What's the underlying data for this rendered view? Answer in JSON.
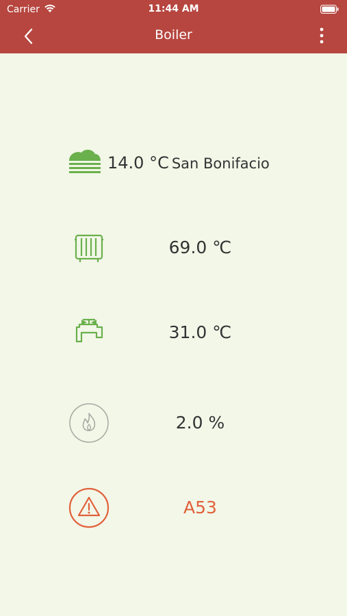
{
  "status_bar": {
    "carrier": "Carrier",
    "time": "11:44 AM"
  },
  "nav": {
    "title": "Boiler",
    "back_icon": "chevron-left-icon",
    "menu_icon": "more-vertical-icon"
  },
  "outdoor": {
    "temperature": "14.0 °C",
    "location": "San Bonifacio",
    "icon": "fog-cloud-icon"
  },
  "heating": {
    "temperature": "69.0 ℃",
    "icon": "radiator-icon"
  },
  "hot_water": {
    "temperature": "31.0 ℃",
    "icon": "tap-icon"
  },
  "flame": {
    "modulation": "2.0 %",
    "icon": "flame-icon"
  },
  "error": {
    "code": "A53",
    "icon": "warning-icon"
  },
  "colors": {
    "header": "#b6463f",
    "background": "#f2f7e8",
    "icon_green": "#6ab04c",
    "icon_gray": "#a8aba3",
    "error": "#e2603a",
    "text": "#333333"
  }
}
